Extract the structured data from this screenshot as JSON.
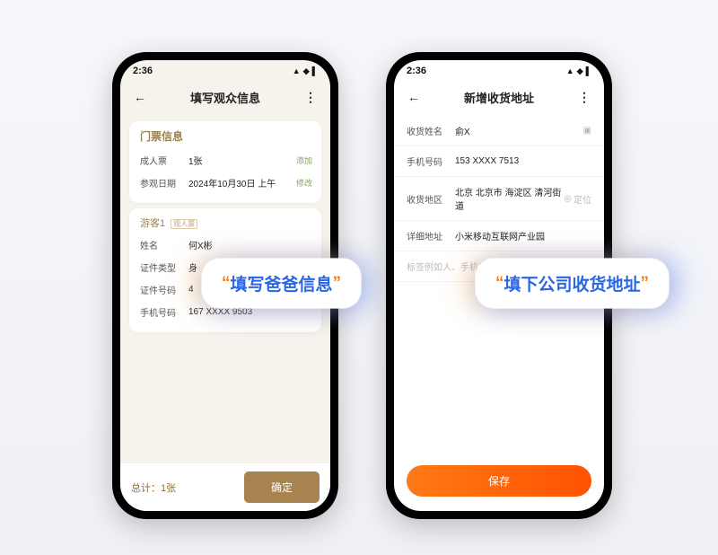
{
  "status_time": "2:36",
  "phone_left": {
    "nav_title": "填写观众信息",
    "section_ticket_title": "门票信息",
    "ticket_type_label": "成人票",
    "ticket_type_value": "1张",
    "ticket_type_action": "添加",
    "visit_date_label": "参观日期",
    "visit_date_value": "2024年10月30日 上午",
    "visit_date_action": "修改",
    "guest_heading": "游客1",
    "guest_tag": "观人票",
    "rows": {
      "name_label": "姓名",
      "name_value": "何X彬",
      "idtype_label": "证件类型",
      "idtype_value": "身",
      "idnum_label": "证件号码",
      "idnum_value": "4",
      "phone_label": "手机号码",
      "phone_value": "167 XXXX 9503"
    },
    "footer_total": "总计：1张",
    "confirm": "确定"
  },
  "phone_right": {
    "nav_title": "新增收货地址",
    "rows": {
      "name_label": "收货姓名",
      "name_value": "俞X",
      "phone_label": "手机号码",
      "phone_value": "153 XXXX 7513",
      "region_label": "收货地区",
      "region_value": "北京 北京市 海淀区 清河街道",
      "region_action": "定位",
      "detail_label": "详细地址",
      "detail_value": "小米移动互联网产业园",
      "tag_placeholder": "标签例如人、手机号、收货地址等"
    },
    "save": "保存"
  },
  "bubbles": {
    "left": "填写爸爸信息",
    "right": "填下公司收货地址"
  }
}
